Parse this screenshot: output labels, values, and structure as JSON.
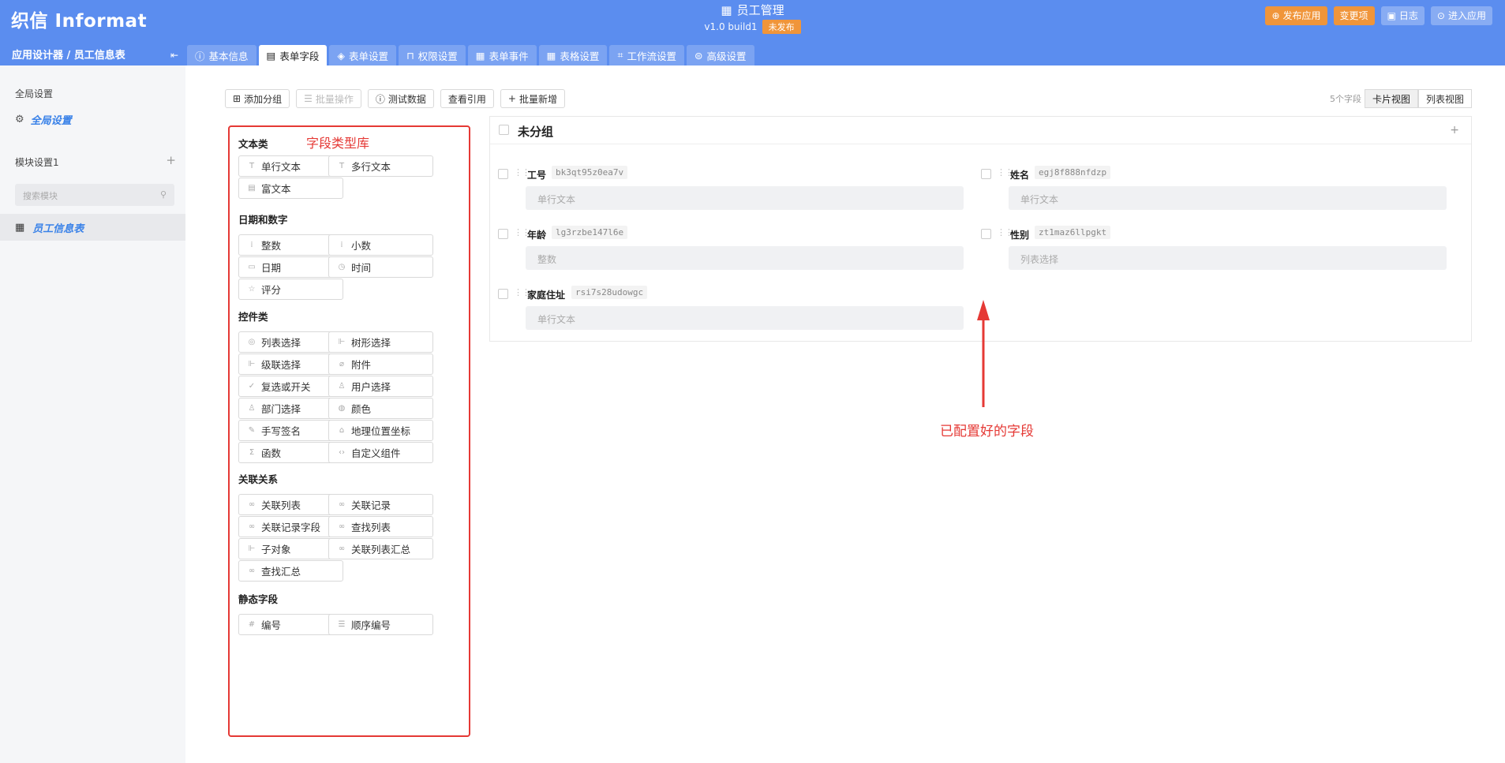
{
  "app": {
    "logo": "织信 Informat",
    "title": "员工管理",
    "version": "v1.0 build1",
    "status": "未发布"
  },
  "topbar": {
    "publish": "发布应用",
    "changes": "变更项",
    "log": "日志",
    "enter": "进入应用"
  },
  "breadcrumb": "应用设计器 / 员工信息表",
  "tabs": [
    "基本信息",
    "表单字段",
    "表单设置",
    "权限设置",
    "表单事件",
    "表格设置",
    "工作流设置",
    "高级设置"
  ],
  "sidebar": {
    "global_header": "全局设置",
    "global_item": "全局设置",
    "module_header": "模块设置1",
    "search_placeholder": "搜索模块",
    "item": "员工信息表"
  },
  "toolbar": {
    "add_group": "添加分组",
    "batch_op": "批量操作",
    "test_data": "测试数据",
    "view_ref": "查看引用",
    "batch_add": "批量新增"
  },
  "view": {
    "count": "5个字段",
    "card": "卡片视图",
    "list": "列表视图"
  },
  "library": {
    "annotation": "字段类型库",
    "categories": [
      {
        "name": "文本类",
        "items": [
          "单行文本",
          "多行文本",
          "富文本"
        ]
      },
      {
        "name": "日期和数字",
        "items": [
          "整数",
          "小数",
          "日期",
          "时间",
          "评分"
        ]
      },
      {
        "name": "控件类",
        "items": [
          "列表选择",
          "树形选择",
          "级联选择",
          "附件",
          "复选或开关",
          "用户选择",
          "部门选择",
          "颜色",
          "手写签名",
          "地理位置坐标",
          "函数",
          "自定义组件"
        ]
      },
      {
        "name": "关联关系",
        "items": [
          "关联列表",
          "关联记录",
          "关联记录字段",
          "查找列表",
          "子对象",
          "关联列表汇总",
          "查找汇总"
        ]
      },
      {
        "name": "静态字段",
        "items": [
          "编号",
          "顺序编号"
        ]
      }
    ]
  },
  "group": {
    "title": "未分组",
    "fields": [
      {
        "name": "工号",
        "id": "bk3qt95z0ea7v",
        "type": "单行文本"
      },
      {
        "name": "姓名",
        "id": "egj8f888nfdzp",
        "type": "单行文本"
      },
      {
        "name": "年龄",
        "id": "lg3rzbe147l6e",
        "type": "整数"
      },
      {
        "name": "性别",
        "id": "zt1maz6llpgkt",
        "type": "列表选择"
      },
      {
        "name": "家庭住址",
        "id": "rsi7s28udowgc",
        "type": "单行文本"
      }
    ]
  },
  "annotation": "已配置好的字段",
  "colors": {
    "topbar": "#5b8def",
    "accent": "#3a82e8",
    "orange": "#f0953a",
    "annotation": "#e53935"
  }
}
